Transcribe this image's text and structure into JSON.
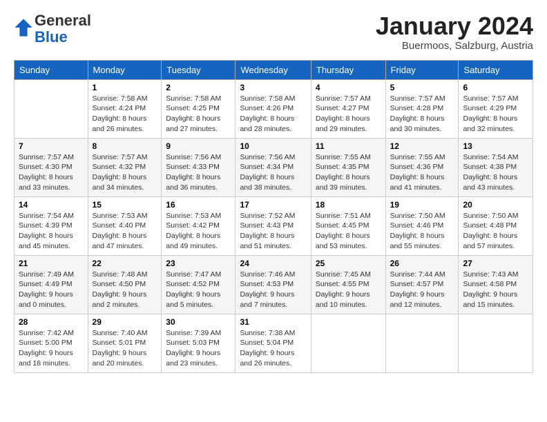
{
  "header": {
    "logo_general": "General",
    "logo_blue": "Blue",
    "month_title": "January 2024",
    "subtitle": "Buermoos, Salzburg, Austria"
  },
  "weekdays": [
    "Sunday",
    "Monday",
    "Tuesday",
    "Wednesday",
    "Thursday",
    "Friday",
    "Saturday"
  ],
  "weeks": [
    [
      {
        "day": "",
        "info": ""
      },
      {
        "day": "1",
        "info": "Sunrise: 7:58 AM\nSunset: 4:24 PM\nDaylight: 8 hours\nand 26 minutes."
      },
      {
        "day": "2",
        "info": "Sunrise: 7:58 AM\nSunset: 4:25 PM\nDaylight: 8 hours\nand 27 minutes."
      },
      {
        "day": "3",
        "info": "Sunrise: 7:58 AM\nSunset: 4:26 PM\nDaylight: 8 hours\nand 28 minutes."
      },
      {
        "day": "4",
        "info": "Sunrise: 7:57 AM\nSunset: 4:27 PM\nDaylight: 8 hours\nand 29 minutes."
      },
      {
        "day": "5",
        "info": "Sunrise: 7:57 AM\nSunset: 4:28 PM\nDaylight: 8 hours\nand 30 minutes."
      },
      {
        "day": "6",
        "info": "Sunrise: 7:57 AM\nSunset: 4:29 PM\nDaylight: 8 hours\nand 32 minutes."
      }
    ],
    [
      {
        "day": "7",
        "info": "Sunrise: 7:57 AM\nSunset: 4:30 PM\nDaylight: 8 hours\nand 33 minutes."
      },
      {
        "day": "8",
        "info": "Sunrise: 7:57 AM\nSunset: 4:32 PM\nDaylight: 8 hours\nand 34 minutes."
      },
      {
        "day": "9",
        "info": "Sunrise: 7:56 AM\nSunset: 4:33 PM\nDaylight: 8 hours\nand 36 minutes."
      },
      {
        "day": "10",
        "info": "Sunrise: 7:56 AM\nSunset: 4:34 PM\nDaylight: 8 hours\nand 38 minutes."
      },
      {
        "day": "11",
        "info": "Sunrise: 7:55 AM\nSunset: 4:35 PM\nDaylight: 8 hours\nand 39 minutes."
      },
      {
        "day": "12",
        "info": "Sunrise: 7:55 AM\nSunset: 4:36 PM\nDaylight: 8 hours\nand 41 minutes."
      },
      {
        "day": "13",
        "info": "Sunrise: 7:54 AM\nSunset: 4:38 PM\nDaylight: 8 hours\nand 43 minutes."
      }
    ],
    [
      {
        "day": "14",
        "info": "Sunrise: 7:54 AM\nSunset: 4:39 PM\nDaylight: 8 hours\nand 45 minutes."
      },
      {
        "day": "15",
        "info": "Sunrise: 7:53 AM\nSunset: 4:40 PM\nDaylight: 8 hours\nand 47 minutes."
      },
      {
        "day": "16",
        "info": "Sunrise: 7:53 AM\nSunset: 4:42 PM\nDaylight: 8 hours\nand 49 minutes."
      },
      {
        "day": "17",
        "info": "Sunrise: 7:52 AM\nSunset: 4:43 PM\nDaylight: 8 hours\nand 51 minutes."
      },
      {
        "day": "18",
        "info": "Sunrise: 7:51 AM\nSunset: 4:45 PM\nDaylight: 8 hours\nand 53 minutes."
      },
      {
        "day": "19",
        "info": "Sunrise: 7:50 AM\nSunset: 4:46 PM\nDaylight: 8 hours\nand 55 minutes."
      },
      {
        "day": "20",
        "info": "Sunrise: 7:50 AM\nSunset: 4:48 PM\nDaylight: 8 hours\nand 57 minutes."
      }
    ],
    [
      {
        "day": "21",
        "info": "Sunrise: 7:49 AM\nSunset: 4:49 PM\nDaylight: 9 hours\nand 0 minutes."
      },
      {
        "day": "22",
        "info": "Sunrise: 7:48 AM\nSunset: 4:50 PM\nDaylight: 9 hours\nand 2 minutes."
      },
      {
        "day": "23",
        "info": "Sunrise: 7:47 AM\nSunset: 4:52 PM\nDaylight: 9 hours\nand 5 minutes."
      },
      {
        "day": "24",
        "info": "Sunrise: 7:46 AM\nSunset: 4:53 PM\nDaylight: 9 hours\nand 7 minutes."
      },
      {
        "day": "25",
        "info": "Sunrise: 7:45 AM\nSunset: 4:55 PM\nDaylight: 9 hours\nand 10 minutes."
      },
      {
        "day": "26",
        "info": "Sunrise: 7:44 AM\nSunset: 4:57 PM\nDaylight: 9 hours\nand 12 minutes."
      },
      {
        "day": "27",
        "info": "Sunrise: 7:43 AM\nSunset: 4:58 PM\nDaylight: 9 hours\nand 15 minutes."
      }
    ],
    [
      {
        "day": "28",
        "info": "Sunrise: 7:42 AM\nSunset: 5:00 PM\nDaylight: 9 hours\nand 18 minutes."
      },
      {
        "day": "29",
        "info": "Sunrise: 7:40 AM\nSunset: 5:01 PM\nDaylight: 9 hours\nand 20 minutes."
      },
      {
        "day": "30",
        "info": "Sunrise: 7:39 AM\nSunset: 5:03 PM\nDaylight: 9 hours\nand 23 minutes."
      },
      {
        "day": "31",
        "info": "Sunrise: 7:38 AM\nSunset: 5:04 PM\nDaylight: 9 hours\nand 26 minutes."
      },
      {
        "day": "",
        "info": ""
      },
      {
        "day": "",
        "info": ""
      },
      {
        "day": "",
        "info": ""
      }
    ]
  ]
}
